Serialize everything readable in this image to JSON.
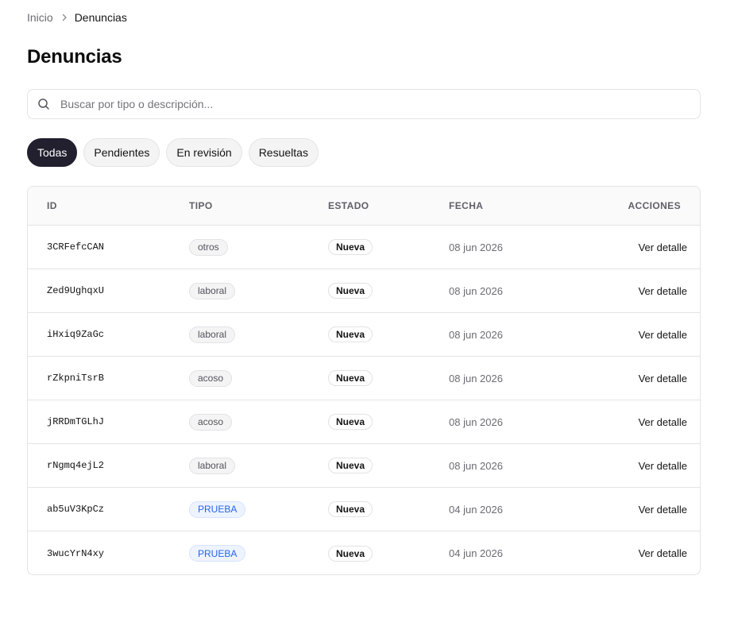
{
  "breadcrumb": {
    "home": "Inicio",
    "current": "Denuncias"
  },
  "page": {
    "title": "Denuncias"
  },
  "search": {
    "placeholder": "Buscar por tipo o descripción..."
  },
  "filters": [
    "Todas",
    "Pendientes",
    "En revisión",
    "Resueltas"
  ],
  "active_filter": "Todas",
  "table": {
    "headers": {
      "id": "ID",
      "tipo": "TIPO",
      "estado": "ESTADO",
      "fecha": "FECHA",
      "acciones": "ACCIONES"
    },
    "rows": [
      {
        "id": "3CRFefcCAN",
        "tipo": "otros",
        "estado": "Nueva",
        "fecha": "08 jun 2026",
        "accion": "Ver detalle"
      },
      {
        "id": "Zed9UghqxU",
        "tipo": "laboral",
        "estado": "Nueva",
        "fecha": "08 jun 2026",
        "accion": "Ver detalle"
      },
      {
        "id": "iHxiq9ZaGc",
        "tipo": "laboral",
        "estado": "Nueva",
        "fecha": "08 jun 2026",
        "accion": "Ver detalle"
      },
      {
        "id": "rZkpniTsrB",
        "tipo": "acoso",
        "estado": "Nueva",
        "fecha": "08 jun 2026",
        "accion": "Ver detalle"
      },
      {
        "id": "jRRDmTGLhJ",
        "tipo": "acoso",
        "estado": "Nueva",
        "fecha": "08 jun 2026",
        "accion": "Ver detalle"
      },
      {
        "id": "rNgmq4ejL2",
        "tipo": "laboral",
        "estado": "Nueva",
        "fecha": "08 jun 2026",
        "accion": "Ver detalle"
      },
      {
        "id": "ab5uV3KpCz",
        "tipo": "PRUEBA",
        "estado": "Nueva",
        "fecha": "04 jun 2026",
        "accion": "Ver detalle"
      },
      {
        "id": "3wucYrN4xy",
        "tipo": "PRUEBA",
        "estado": "Nueva",
        "fecha": "04 jun 2026",
        "accion": "Ver detalle"
      }
    ]
  },
  "icons": {
    "breadcrumb_separator": "chevron-right-icon",
    "search": "search-icon"
  },
  "colors": {
    "active_chip": "#221f2e",
    "test_badge": "#2563eb",
    "border": "#e4e4e7"
  }
}
